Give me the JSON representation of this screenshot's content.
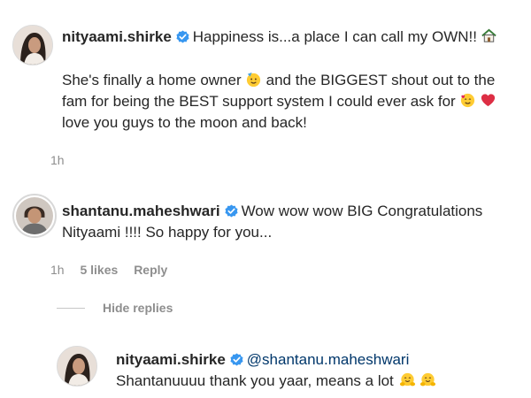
{
  "post": {
    "username": "nityaami.shirke",
    "caption_line1": "Happiness is...a place I can call my OWN!!",
    "caption_line2": "She's finally a home owner",
    "caption_line2b": "and the BIGGEST shout out to the",
    "caption_line3": "fam for being the BEST support system I could ever ask for",
    "caption_line4": "love you guys to the moon and back!",
    "time": "1h",
    "icons": [
      "house-emoji",
      "partying-face-emoji",
      "smiling-hearts-emoji",
      "red-heart-emoji"
    ]
  },
  "comment": {
    "username": "shantanu.maheshwari",
    "text_line1": "Wow wow wow BIG Congratulations",
    "text_line2": "Nityaami !!!! So happy for you...",
    "time": "1h",
    "likes": "5 likes",
    "reply_label": "Reply"
  },
  "replies_toggle": {
    "label": "Hide replies"
  },
  "reply": {
    "username": "nityaami.shirke",
    "mention": "@shantanu.maheshwari",
    "text": "Shantanuuuu thank you yaar, means a lot",
    "icons": [
      "hugging-face-emoji",
      "hugging-face-emoji"
    ]
  },
  "colors": {
    "text": "#262626",
    "secondary": "#8e8e8e",
    "verified": "#3897f0",
    "mention": "#00376b"
  }
}
